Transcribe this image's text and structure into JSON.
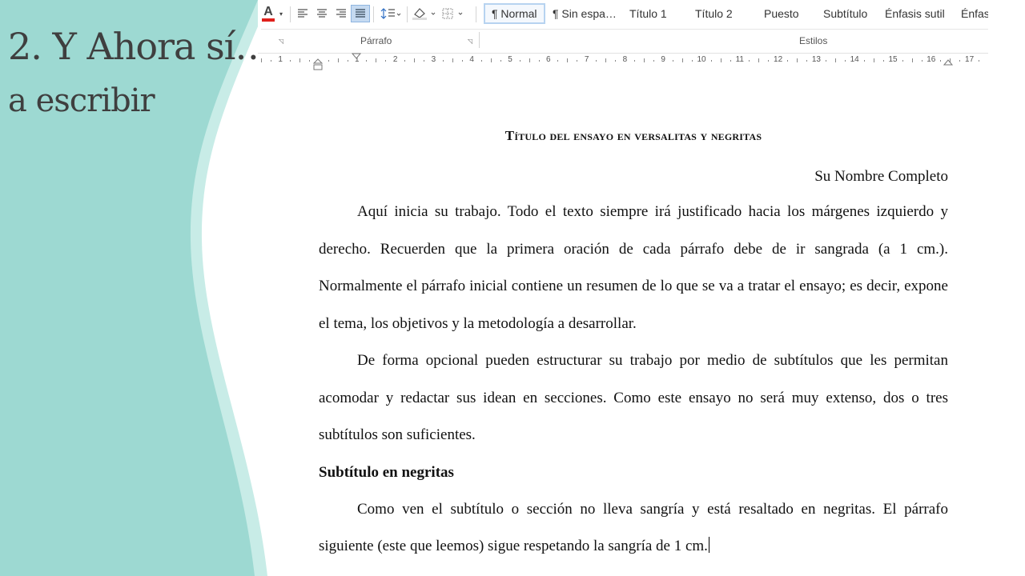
{
  "slide": {
    "title_line1": "2. Y Ahora sí…",
    "title_line2": "a escribir"
  },
  "ribbon": {
    "font_color_glyph": "A",
    "group_paragraph": "Párrafo",
    "group_styles": "Estilos",
    "styles": [
      "¶ Normal",
      "¶ Sin espa…",
      "Título 1",
      "Título 2",
      "Puesto",
      "Subtítulo",
      "Énfasis sutil",
      "Énfas"
    ],
    "active_style": "¶ Normal",
    "icons": [
      "font-color-icon",
      "align-left-icon",
      "align-center-icon",
      "align-right-icon",
      "justify-icon",
      "line-spacing-icon",
      "shading-icon",
      "borders-icon"
    ]
  },
  "ruler": {
    "numbers": [
      "1",
      "1",
      "2",
      "3",
      "4",
      "5",
      "6",
      "7",
      "8",
      "9",
      "10",
      "11",
      "12",
      "13",
      "14",
      "15",
      "16",
      "17"
    ]
  },
  "document": {
    "title": "Título del ensayo en versalitas y negritas",
    "author": "Su Nombre Completo",
    "para1": "Aquí inicia su trabajo. Todo el texto siempre irá justificado hacia los márgenes izquierdo y derecho. Recuerden que la primera oración de cada párrafo debe de ir sangrada (a 1 cm.). Normalmente el párrafo inicial contiene un resumen de lo que se va a tratar el ensayo; es decir, expone el tema, los objetivos y la metodología a desarrollar.",
    "para2": "De forma opcional pueden estructurar su trabajo por medio de subtítulos que les permitan acomodar y redactar sus idean en secciones. Como este ensayo no será muy extenso, dos o tres subtítulos son suficientes.",
    "subtitle": "Subtítulo en negritas",
    "para3": "Como ven el subtítulo o sección no lleva sangría y está resaltado en negritas. El párrafo siguiente (este que leemos) sigue respetando la sangría de 1 cm."
  },
  "colors": {
    "teal": "#9dd9d2",
    "teal_light": "#c8ece7",
    "font_red": "#e0201b",
    "title_gray": "#3f3f3f"
  }
}
